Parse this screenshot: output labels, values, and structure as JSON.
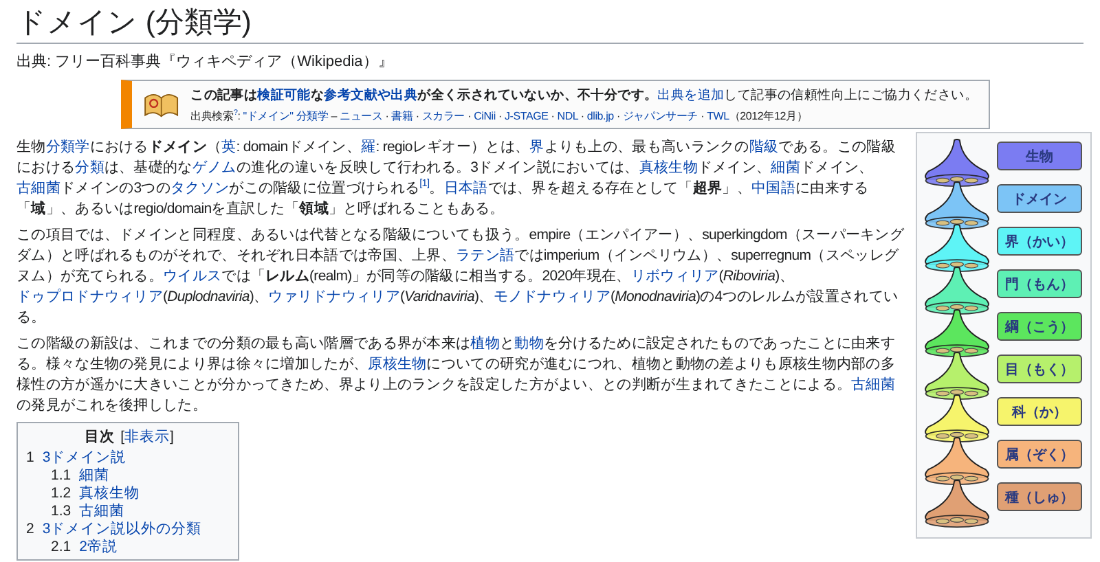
{
  "title": "ドメイン (分類学)",
  "subtitle": "出典: フリー百科事典『ウィキペディア（Wikipedia）』",
  "notice": {
    "line1": [
      {
        "kind": "b",
        "text": "この記事は"
      },
      {
        "kind": "ab",
        "text": "検証可能"
      },
      {
        "kind": "b",
        "text": "な"
      },
      {
        "kind": "ab",
        "text": "参考文献や出典"
      },
      {
        "kind": "b",
        "text": "が全く示されていないか、不十分です。"
      },
      {
        "kind": "a",
        "text": "出典を追加"
      },
      {
        "kind": "t",
        "text": "して記事の信頼性向上にご協力ください。"
      }
    ],
    "line2": [
      {
        "kind": "t",
        "text": "出典検索"
      },
      {
        "kind": "sup",
        "text": "?"
      },
      {
        "kind": "t",
        "text": ": "
      },
      {
        "kind": "a",
        "text": "\"ドメイン\" 分類学"
      },
      {
        "kind": "t",
        "text": " – "
      },
      {
        "kind": "a",
        "text": "ニュース"
      },
      {
        "kind": "t",
        "text": " · "
      },
      {
        "kind": "a",
        "text": "書籍"
      },
      {
        "kind": "t",
        "text": " · "
      },
      {
        "kind": "a",
        "text": "スカラー"
      },
      {
        "kind": "t",
        "text": " · "
      },
      {
        "kind": "a",
        "text": "CiNii"
      },
      {
        "kind": "t",
        "text": " · "
      },
      {
        "kind": "a",
        "text": "J-STAGE"
      },
      {
        "kind": "t",
        "text": " · "
      },
      {
        "kind": "a",
        "text": "NDL"
      },
      {
        "kind": "t",
        "text": " · "
      },
      {
        "kind": "a",
        "text": "dlib.jp"
      },
      {
        "kind": "t",
        "text": " · "
      },
      {
        "kind": "a",
        "text": "ジャパンサーチ"
      },
      {
        "kind": "t",
        "text": " · "
      },
      {
        "kind": "a",
        "text": "TWL"
      },
      {
        "kind": "t",
        "text": "（2012年12月）"
      }
    ]
  },
  "paragraphs": [
    [
      {
        "kind": "t",
        "text": "生物"
      },
      {
        "kind": "a",
        "text": "分類学"
      },
      {
        "kind": "t",
        "text": "における"
      },
      {
        "kind": "b",
        "text": "ドメイン"
      },
      {
        "kind": "t",
        "text": "（"
      },
      {
        "kind": "a",
        "text": "英"
      },
      {
        "kind": "t",
        "text": ": domainドメイン、"
      },
      {
        "kind": "a",
        "text": "羅"
      },
      {
        "kind": "t",
        "text": ": regioレギオー）とは、"
      },
      {
        "kind": "a",
        "text": "界"
      },
      {
        "kind": "t",
        "text": "よりも上の、最も高いランクの"
      },
      {
        "kind": "a",
        "text": "階級"
      },
      {
        "kind": "t",
        "text": "である。この階級における"
      },
      {
        "kind": "a",
        "text": "分類"
      },
      {
        "kind": "t",
        "text": "は、基礎的な"
      },
      {
        "kind": "a",
        "text": "ゲノム"
      },
      {
        "kind": "t",
        "text": "の進化の違いを反映して行われる。3ドメイン説においては、"
      },
      {
        "kind": "a",
        "text": "真核生物"
      },
      {
        "kind": "t",
        "text": "ドメイン、"
      },
      {
        "kind": "a",
        "text": "細菌"
      },
      {
        "kind": "t",
        "text": "ドメイン、"
      },
      {
        "kind": "a",
        "text": "古細菌"
      },
      {
        "kind": "t",
        "text": "ドメインの3つの"
      },
      {
        "kind": "a",
        "text": "タクソン"
      },
      {
        "kind": "t",
        "text": "がこの階級に位置づけられる"
      },
      {
        "kind": "sup",
        "text": "[1]"
      },
      {
        "kind": "t",
        "text": "。"
      },
      {
        "kind": "a",
        "text": "日本語"
      },
      {
        "kind": "t",
        "text": "では、界を超える存在として「"
      },
      {
        "kind": "b",
        "text": "超界"
      },
      {
        "kind": "t",
        "text": "」、"
      },
      {
        "kind": "a",
        "text": "中国語"
      },
      {
        "kind": "t",
        "text": "に由来する「"
      },
      {
        "kind": "b",
        "text": "域"
      },
      {
        "kind": "t",
        "text": "」、あるいはregio/domainを直訳した「"
      },
      {
        "kind": "b",
        "text": "領域"
      },
      {
        "kind": "t",
        "text": "」と呼ばれることもある。"
      }
    ],
    [
      {
        "kind": "t",
        "text": "この項目では、ドメインと同程度、あるいは代替となる階級についても扱う。empire（エンパイアー）、superkingdom（スーパーキングダム）と呼ばれるものがそれで、それぞれ日本語では帝国、上界、"
      },
      {
        "kind": "a",
        "text": "ラテン語"
      },
      {
        "kind": "t",
        "text": "ではimperium（インペリウム）、superregnum（スペッレグヌム）が充てられる。"
      },
      {
        "kind": "a",
        "text": "ウイルス"
      },
      {
        "kind": "t",
        "text": "では「"
      },
      {
        "kind": "b",
        "text": "レルム"
      },
      {
        "kind": "t",
        "text": "(realm)」が同等の階級に相当する。2020年現在、"
      },
      {
        "kind": "a",
        "text": "リボウィリア"
      },
      {
        "kind": "t",
        "text": "("
      },
      {
        "kind": "i",
        "text": "Riboviria"
      },
      {
        "kind": "t",
        "text": ")、"
      },
      {
        "kind": "a",
        "text": "ドゥプロドナウィリア"
      },
      {
        "kind": "t",
        "text": "("
      },
      {
        "kind": "i",
        "text": "Duplodnaviria"
      },
      {
        "kind": "t",
        "text": ")、"
      },
      {
        "kind": "a",
        "text": "ウァリドナウィリア"
      },
      {
        "kind": "t",
        "text": "("
      },
      {
        "kind": "i",
        "text": "Varidnaviria"
      },
      {
        "kind": "t",
        "text": ")、"
      },
      {
        "kind": "a",
        "text": "モノドナウィリア"
      },
      {
        "kind": "t",
        "text": "("
      },
      {
        "kind": "i",
        "text": "Monodnaviria"
      },
      {
        "kind": "t",
        "text": ")の4つのレルムが設置されている。"
      }
    ],
    [
      {
        "kind": "t",
        "text": "この階級の新設は、これまでの分類の最も高い階層である界が本来は"
      },
      {
        "kind": "a",
        "text": "植物"
      },
      {
        "kind": "t",
        "text": "と"
      },
      {
        "kind": "a",
        "text": "動物"
      },
      {
        "kind": "t",
        "text": "を分けるために設定されたものであったことに由来する。様々な生物の発見により界は徐々に増加したが、"
      },
      {
        "kind": "a",
        "text": "原核生物"
      },
      {
        "kind": "t",
        "text": "についての研究が進むにつれ、植物と動物の差よりも原核生物内部の多様性の方が遥かに大きいことが分かってきため、界より上のランクを設定した方がよい、との判断が生まれてきたことによる。"
      },
      {
        "kind": "a",
        "text": "古細菌"
      },
      {
        "kind": "t",
        "text": "の発見がこれを後押しした。"
      }
    ]
  ],
  "toc": {
    "title": "目次",
    "toggle_open": "[",
    "toggle": "非表示",
    "toggle_close": "]",
    "items": [
      {
        "number": "1",
        "label": "3ドメイン説",
        "children": [
          {
            "number": "1.1",
            "label": "細菌"
          },
          {
            "number": "1.2",
            "label": "真核生物"
          },
          {
            "number": "1.3",
            "label": "古細菌"
          }
        ]
      },
      {
        "number": "2",
        "label": "3ドメイン説以外の分類",
        "children": [
          {
            "number": "2.1",
            "label": "2帝説"
          }
        ]
      }
    ]
  },
  "ranks": [
    {
      "label": "生物",
      "color": "#7b7cf2"
    },
    {
      "label": "ドメイン",
      "color": "#7cc4f6"
    },
    {
      "label": "界（かい）",
      "color": "#5ef4f6"
    },
    {
      "label": "門（もん）",
      "color": "#5ef0b4"
    },
    {
      "label": "綱（こう）",
      "color": "#5ce65e"
    },
    {
      "label": "目（もく）",
      "color": "#b6f06c"
    },
    {
      "label": "科（か）",
      "color": "#f6f46c"
    },
    {
      "label": "属（ぞく）",
      "color": "#f6b47c"
    },
    {
      "label": "種（しゅ）",
      "color": "#e0a074"
    }
  ]
}
